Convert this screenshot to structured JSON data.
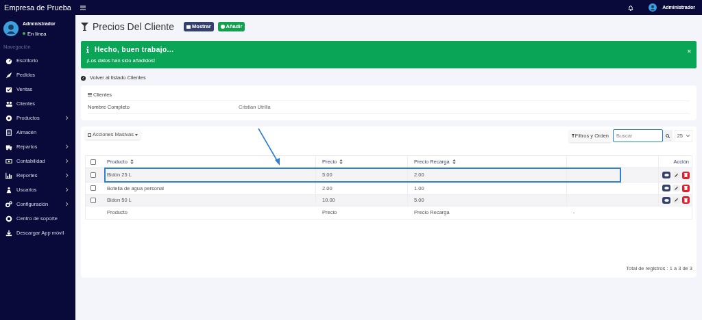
{
  "brand": "Empresa de Prueba",
  "topbar": {
    "user": "Administrador"
  },
  "user_panel": {
    "name": "Administrador",
    "status": "En línea"
  },
  "sidebar": {
    "heading": "Navegación",
    "items": [
      {
        "label": "Escritorio",
        "has_submenu": false
      },
      {
        "label": "Pedidos",
        "has_submenu": false
      },
      {
        "label": "Ventas",
        "has_submenu": false
      },
      {
        "label": "Clientes",
        "has_submenu": false
      },
      {
        "label": "Productos",
        "has_submenu": true
      },
      {
        "label": "Almacén",
        "has_submenu": false
      },
      {
        "label": "Repartos",
        "has_submenu": true
      },
      {
        "label": "Contabilidad",
        "has_submenu": true
      },
      {
        "label": "Reportes",
        "has_submenu": true
      },
      {
        "label": "Usuarios",
        "has_submenu": true
      },
      {
        "label": "Configuración",
        "has_submenu": true
      },
      {
        "label": "Centro de soporte",
        "has_submenu": false
      },
      {
        "label": "Descargar App móvil",
        "has_submenu": false
      }
    ]
  },
  "page": {
    "title": "Precios Del Cliente",
    "buttons": [
      {
        "label": "Mostrar",
        "kind": "show"
      },
      {
        "label": "Añadir",
        "kind": "add"
      }
    ]
  },
  "alert": {
    "title": "Hecho, buen trabajo...",
    "message": "¡Los datos han sido añadidos!",
    "close": "×"
  },
  "back_link": "Volver al listado Clientes",
  "client_card": {
    "heading": "Clientes",
    "field": "Nombre Completo",
    "value": "Cristian Utrilla"
  },
  "toolbar": {
    "bulk_actions": "Acciones Masivas",
    "filters": "Filtros y Orden",
    "search": {
      "placeholder": "Buscar"
    },
    "page_size": "25"
  },
  "table": {
    "select_all": {
      "checked": false
    },
    "columns": [
      {
        "label": "Producto",
        "sortable": true
      },
      {
        "label": "Precio",
        "sortable": true
      },
      {
        "label": "Precio Recarga",
        "sortable": true
      },
      {
        "label": "Acción",
        "sortable": false
      }
    ],
    "rows": [
      {
        "cells": [
          "Bidón 25 L",
          "5.00",
          "2.00"
        ],
        "highlighted": true,
        "checked": false
      },
      {
        "cells": [
          "Botella de agua personal",
          "2.00",
          "1.00"
        ],
        "highlighted": false,
        "checked": false
      },
      {
        "cells": [
          "Bidon 50 L",
          "10.00",
          "5.00"
        ],
        "highlighted": false,
        "checked": false
      }
    ],
    "footer": [
      "Producto",
      "Precio",
      "Precio Recarga",
      "-"
    ]
  },
  "total": "Total de registros : 1 a 3 de 3"
}
